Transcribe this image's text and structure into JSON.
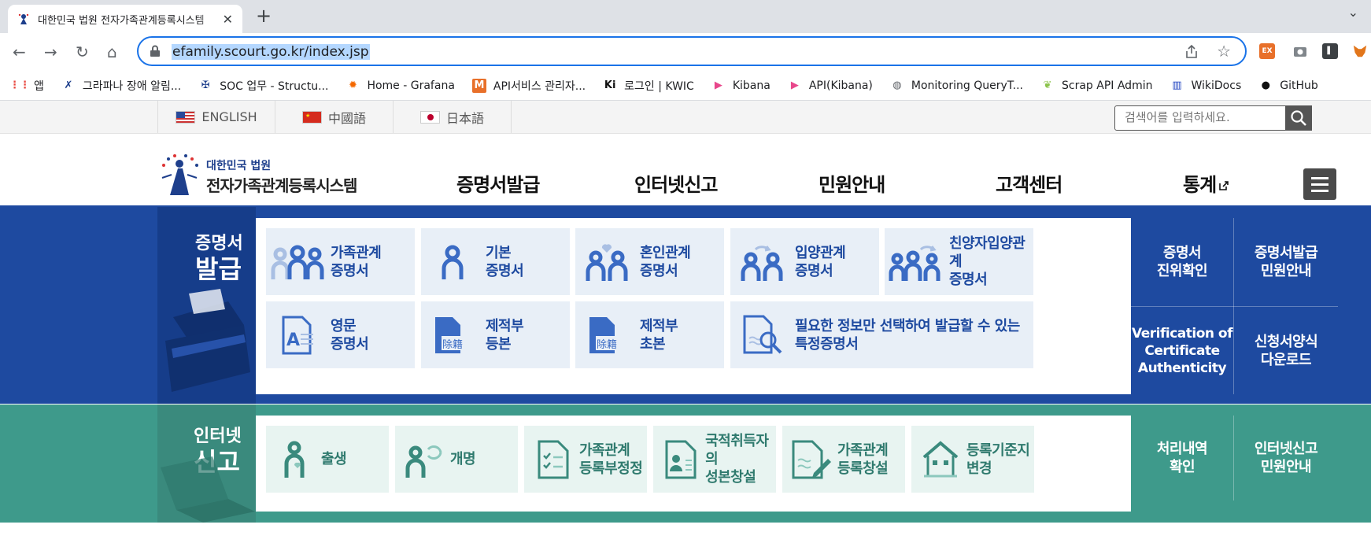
{
  "browser": {
    "tab_title": "대한민국 법원 전자가족관계등록시스템",
    "url": "efamily.scourt.go.kr/index.jsp",
    "bookmarks": [
      {
        "label": "앱",
        "icon": "apps-grid-icon"
      },
      {
        "label": "그라파나 장애 알림...",
        "icon": "grafana-alert-icon"
      },
      {
        "label": "SOC 업무 - Structu...",
        "icon": "soc-icon"
      },
      {
        "label": "Home - Grafana",
        "icon": "grafana-icon"
      },
      {
        "label": "API서비스 관리자...",
        "icon": "m-icon"
      },
      {
        "label": "로그인 | KWIC",
        "icon": "kwic-icon"
      },
      {
        "label": "Kibana",
        "icon": "kibana-icon"
      },
      {
        "label": "API(Kibana)",
        "icon": "kibana-icon"
      },
      {
        "label": "Monitoring QueryT...",
        "icon": "globe-icon"
      },
      {
        "label": "Scrap API Admin",
        "icon": "leaf-icon"
      },
      {
        "label": "WikiDocs",
        "icon": "book-icon"
      },
      {
        "label": "GitHub",
        "icon": "github-icon"
      }
    ],
    "extensions": [
      "EX"
    ]
  },
  "langbar": {
    "languages": [
      {
        "label": "ENGLISH",
        "flag": "us-flag-icon"
      },
      {
        "label": "中國語",
        "flag": "cn-flag-icon"
      },
      {
        "label": "日本語",
        "flag": "jp-flag-icon"
      }
    ],
    "search_placeholder": "검색어를 입력하세요."
  },
  "header": {
    "logo_line1": "대한민국 법원",
    "logo_line2": "전자가족관계등록시스템",
    "nav": [
      "증명서발급",
      "인터넷신고",
      "민원안내",
      "고객센터",
      "통계"
    ]
  },
  "cert": {
    "side_top": "증명서",
    "side_bottom": "발급",
    "items": [
      {
        "label": "가족관계\n증명서",
        "icon": "family-icon"
      },
      {
        "label": "기본\n증명서",
        "icon": "person-icon"
      },
      {
        "label": "혼인관계\n증명서",
        "icon": "couple-heart-icon"
      },
      {
        "label": "입양관계\n증명서",
        "icon": "adoption-icon"
      },
      {
        "label": "친양자입양관계\n증명서",
        "icon": "full-adoption-icon"
      },
      {
        "label": "영문\n증명서",
        "icon": "english-doc-icon"
      },
      {
        "label": "제적부\n등본",
        "icon": "register-doc-icon"
      },
      {
        "label": "제적부\n초본",
        "icon": "register-doc-icon"
      },
      {
        "label": "필요한 정보만 선택하여 발급할 수 있는\n특정증명서",
        "icon": "doc-search-icon"
      }
    ],
    "register_badge": "除籍",
    "links": [
      "증명서\n진위확인",
      "증명서발급\n민원안내",
      "Verification of\nCertificate\nAuthenticity",
      "신청서양식\n다운로드"
    ]
  },
  "report": {
    "side_top": "인터넷",
    "side_bottom": "신고",
    "items": [
      {
        "label": "출생",
        "icon": "birth-icon"
      },
      {
        "label": "개명",
        "icon": "rename-icon"
      },
      {
        "label": "가족관계\n등록부정정",
        "icon": "checklist-icon"
      },
      {
        "label": "국적취득자의\n성본창설",
        "icon": "id-card-icon"
      },
      {
        "label": "가족관계\n등록창설",
        "icon": "doc-pen-icon"
      },
      {
        "label": "등록기준지\n변경",
        "icon": "house-icon"
      }
    ],
    "links": [
      "처리내역\n확인",
      "인터넷신고\n민원안내"
    ]
  },
  "colors": {
    "cert_bg": "#1e4aa0",
    "report_bg": "#3e9a8b",
    "cert_icon": "#3a6bc4",
    "report_icon": "#3a8a7d"
  }
}
